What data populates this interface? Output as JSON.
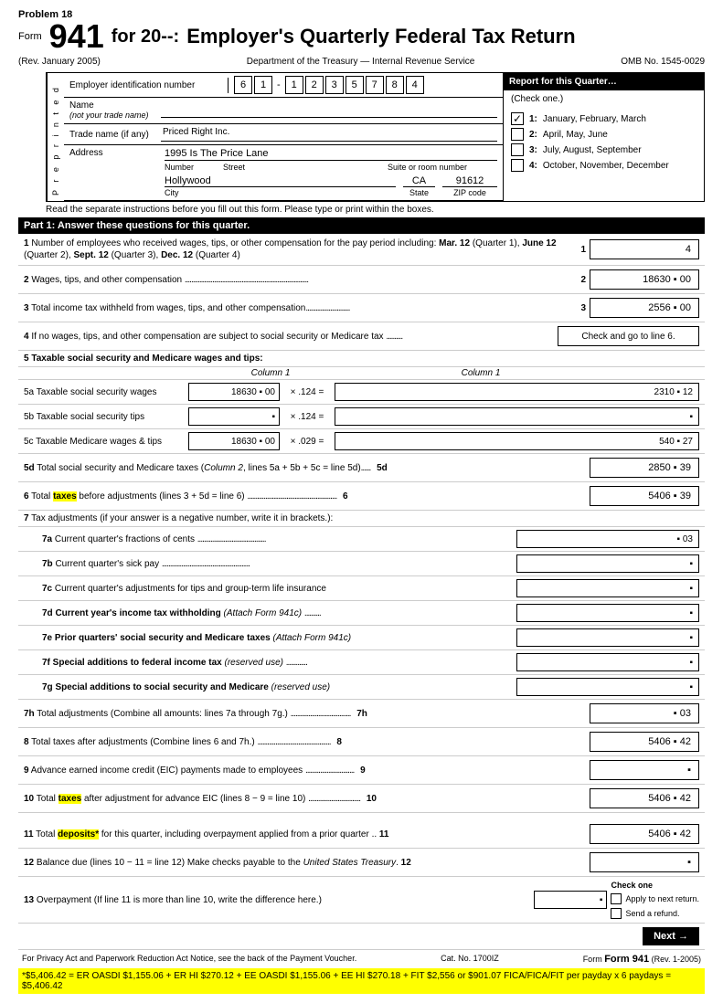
{
  "problem": "Problem 18",
  "form": {
    "number": "941",
    "for_year": "for 20--:",
    "title": "Employer's Quarterly Federal Tax Return",
    "rev": "(Rev. January 2005)",
    "dept": "Department of the Treasury — Internal Revenue Service",
    "omb": "OMB No. 1545-0029"
  },
  "employer": {
    "id_label": "Employer identification number",
    "ein_digits": [
      "6",
      "1",
      "-",
      "1",
      "2",
      "3",
      "5",
      "7",
      "8",
      "4"
    ],
    "name_label": "Name",
    "name_sublabel": "(not your trade name)",
    "name_value": "",
    "trade_label": "Trade name (if any)",
    "trade_value": "Priced Right Inc.",
    "addr_label": "Address",
    "addr_number": "",
    "addr_number_lbl": "Number",
    "addr_street": "1995 Is The Price Lane",
    "addr_street_lbl": "Street",
    "addr_suite": "",
    "addr_suite_lbl": "Suite or room number",
    "addr_city": "Hollywood",
    "addr_city_lbl": "City",
    "addr_state": "CA",
    "addr_state_lbl": "State",
    "addr_zip": "91612",
    "addr_zip_lbl": "ZIP code"
  },
  "report_box": {
    "header": "Report for this Quarter…",
    "subheader": "(Check one.)",
    "quarters": [
      {
        "num": "1:",
        "label": "January, February, March",
        "checked": true
      },
      {
        "num": "2:",
        "label": "April, May, June",
        "checked": false
      },
      {
        "num": "3:",
        "label": "July, August, September",
        "checked": false
      },
      {
        "num": "4:",
        "label": "October, November, December",
        "checked": false
      }
    ]
  },
  "preprinted": "P r e p r i n t e d",
  "read_line": "Read the separate instructions before you fill out this form. Please type or print within the boxes.",
  "part1": {
    "header": "Part 1: Answer these questions for this quarter.",
    "lines": [
      {
        "id": "1",
        "text": "1 Number of employees who received wages, tips, or other compensation for the pay period including: Mar. 12 (Quarter 1), June 12 (Quarter 2), Sept. 12 (Quarter 3), Dec. 12 (Quarter 4)",
        "line_num": "1",
        "answer": "4"
      },
      {
        "id": "2",
        "text": "2 Wages, tips, and other compensation",
        "dots": "........................................................................",
        "line_num": "2",
        "answer": "18630 . 00"
      },
      {
        "id": "3",
        "text": "3 Total income tax withheld from wages, tips, and other compensation",
        "dots": "............................",
        "line_num": "3",
        "answer": "2556 . 00"
      },
      {
        "id": "4",
        "text": "4 If no wages, tips, and other compensation are subject to social security or Medicare tax",
        "dots": "..........",
        "line_num": "",
        "answer": "Check and go to line 6."
      }
    ]
  },
  "line5": {
    "header": "5 Taxable social security and Medicare wages and tips:",
    "col1_label": "Column 1",
    "col2_label": "Column 1",
    "rows": [
      {
        "label": "5a Taxable social security wages",
        "col1": "18630 . 00",
        "mult": "× .124 =",
        "col2": "2310 . 12"
      },
      {
        "label": "5b Taxable social security tips",
        "col1": "",
        "mult": "× .124 =",
        "col2": ""
      },
      {
        "label": "5c Taxable Medicare wages & tips",
        "col1": "18630 . 00",
        "mult": "× .029 =",
        "col2": "540 . 27"
      }
    ],
    "line5d": {
      "text": "5d Total social security and Medicare taxes (Column 2, lines 5a + 5b + 5c = line 5d)",
      "dots": "......",
      "line_num": "5d",
      "answer": "2850 . 39"
    }
  },
  "line6": {
    "text": "6 Total taxes before adjustments (lines 3 + 5d = line 6)",
    "dots": ".......................................................",
    "line_num": "6",
    "answer": "5406 . 39",
    "highlight": true
  },
  "line7": {
    "header": "7 Tax adjustments (if your answer is a negative number, write it in brackets.):",
    "rows": [
      {
        "id": "7a",
        "text": "7a Current quarter's fractions of cents",
        "dots": "..........................................",
        "answer": ". 03"
      },
      {
        "id": "7b",
        "text": "7b Current quarter's sick pay",
        "dots": "......................................................",
        "answer": ""
      },
      {
        "id": "7c",
        "text": "7c Current quarter's adjustments for tips and group-term life insurance",
        "answer": ""
      },
      {
        "id": "7d",
        "text": "7d Current year's income tax withholding",
        "italic": "(Attach Form 941c)",
        "dots": "..........",
        "answer": ""
      },
      {
        "id": "7e",
        "text": "7e Prior quarters' social security and Medicare taxes",
        "italic": "(Attach Form 941c)",
        "answer": ""
      },
      {
        "id": "7f",
        "text": "7f Special additions to federal income tax",
        "italic": "(reserved use)",
        "dots": ".............",
        "answer": ""
      },
      {
        "id": "7g",
        "text": "7g Special additions to social security and Medicare",
        "italic": "(reserved use)",
        "answer": ""
      }
    ],
    "line7h": {
      "text": "7h Total adjustments (Combine all amounts: lines 7a through 7g.)",
      "dots": "...................................",
      "line_num": "7h",
      "answer": ". 03"
    }
  },
  "line8": {
    "text": "8 Total taxes after adjustments (Combine lines 6 and 7h.)",
    "dots": ".............................................",
    "line_num": "8",
    "answer": "5406 . 42"
  },
  "line9": {
    "text": "9 Advance earned income credit (EIC) payments made to employees",
    "dots": "..............................",
    "line_num": "9",
    "answer": ""
  },
  "line10": {
    "text": "10 Total taxes after adjustment for advance EIC (lines 8 − 9 = line 10)",
    "dots": "................................",
    "line_num": "10",
    "answer": "5406 . 42",
    "highlight": true
  },
  "line11": {
    "text": "11 Total deposits* for this quarter, including overpayment applied from a prior quarter ..",
    "line_num": "11",
    "answer": "5406 . 42",
    "highlight": true
  },
  "line12": {
    "text": "12 Balance due (lines 10 − 11 = line 12) Make checks payable to the United States Treasury.",
    "line_num": "12",
    "answer": ""
  },
  "line13": {
    "text": "13 Overpayment (If line 11 is more than line 10, write the difference here.)",
    "answer": "",
    "check_options": [
      "Apply to next return.",
      "Send a refund."
    ]
  },
  "footer": {
    "privacy_text": "For Privacy Act and Paperwork Reduction Act Notice, see the back of the Payment Voucher.",
    "cat_no": "Cat. No. 1700IZ",
    "form_ref": "Form 941",
    "rev_ref": "(Rev. 1-2005)"
  },
  "note": "*$5,406.42 = ER OASDI $1,155.06 + ER HI $270.12 + EE OASDI $1,155.06 + EE HI $270.18 + FIT $2,556 or $901.07 FICA/FICA/FIT per payday x 6 paydays = $5,406.42",
  "next_button": "Next →"
}
